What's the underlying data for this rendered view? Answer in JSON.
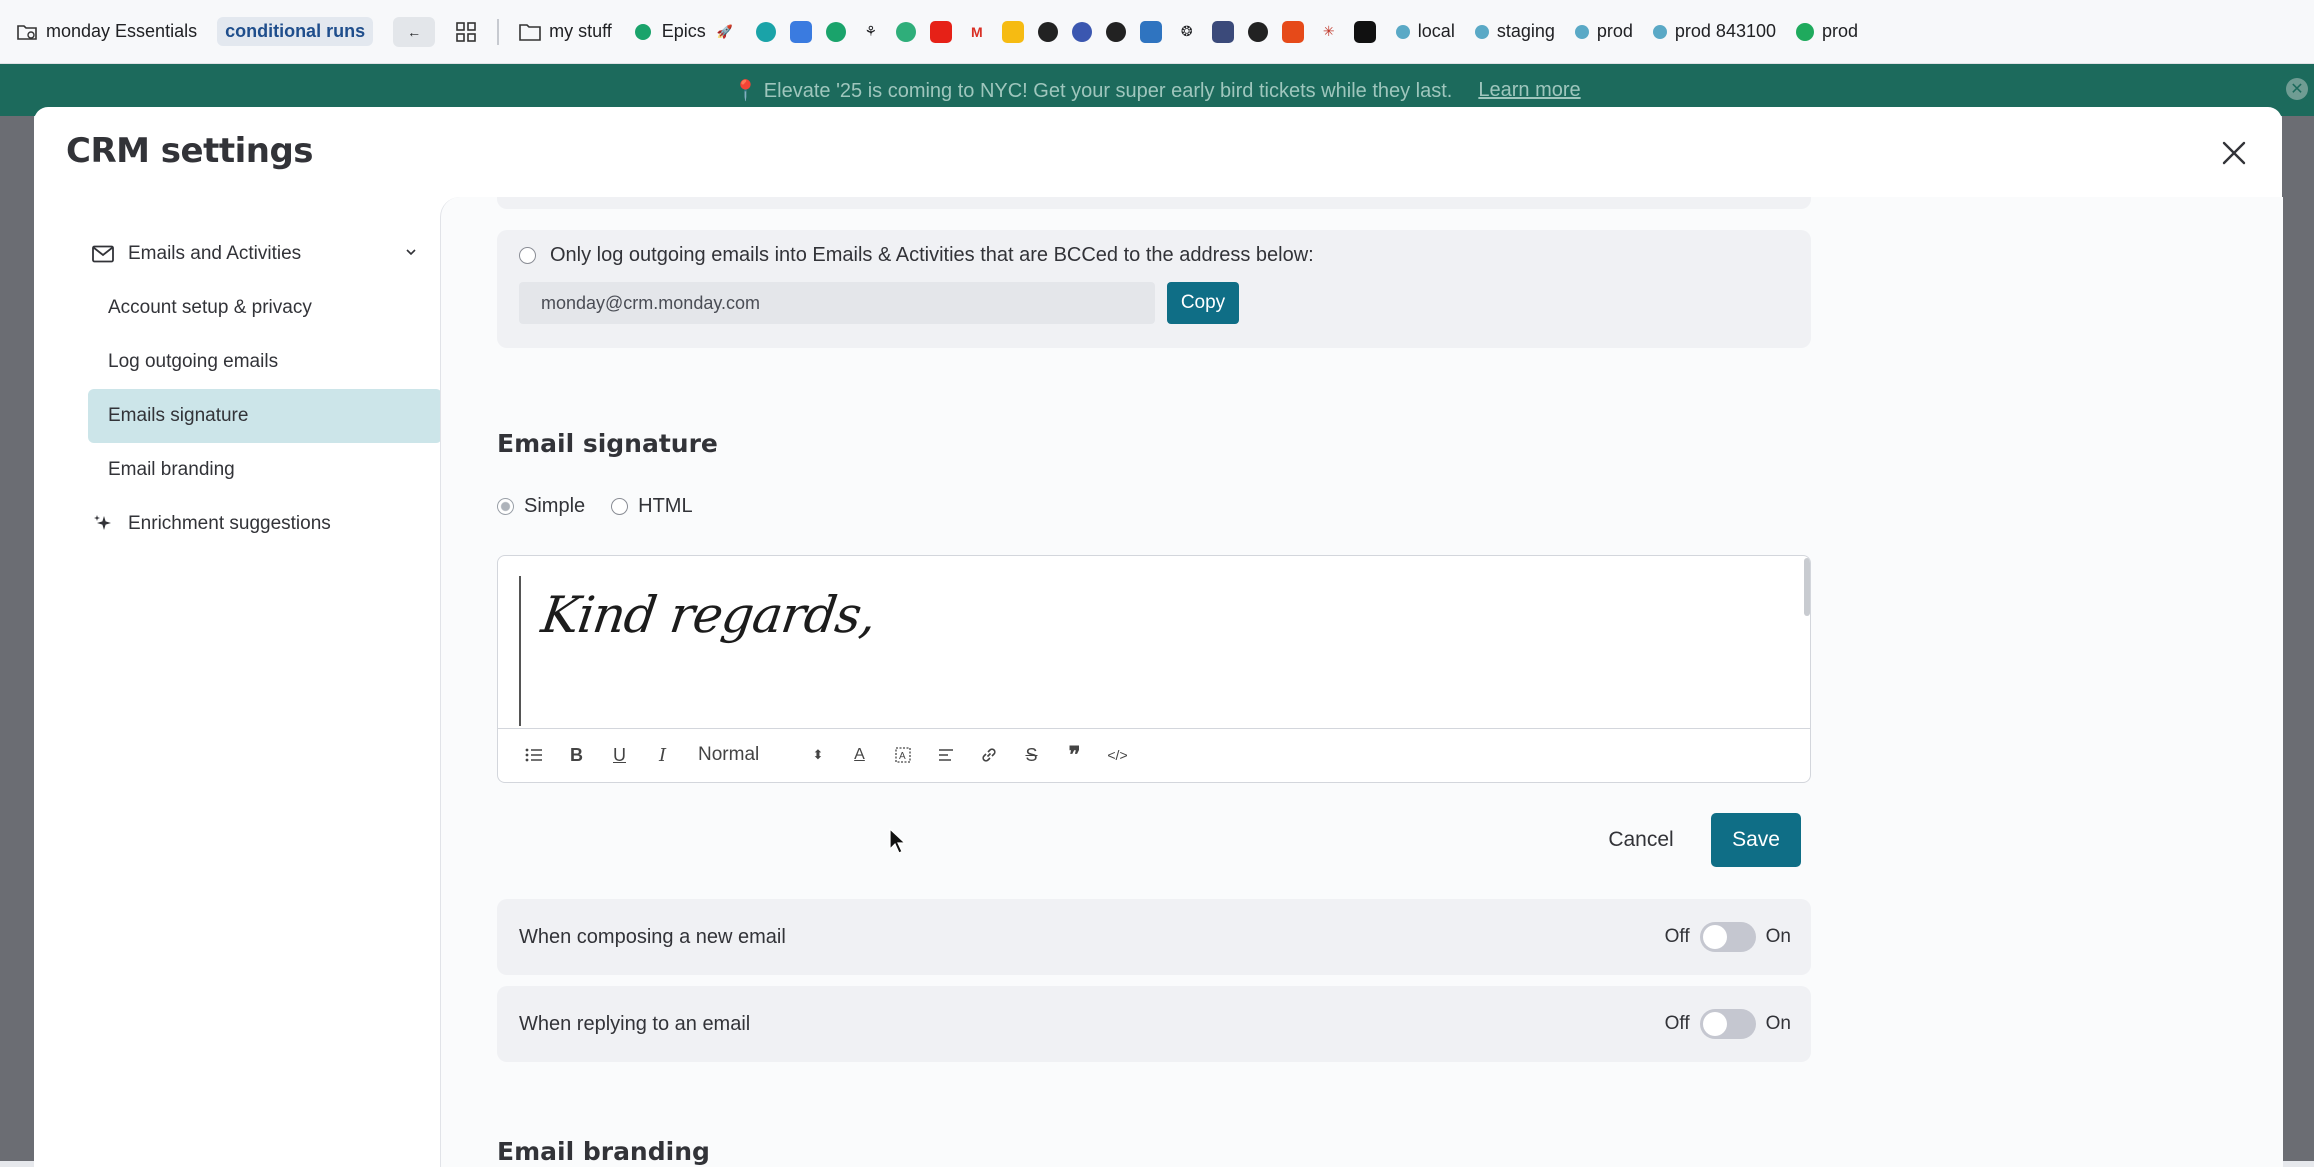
{
  "bookmarks": {
    "items": [
      {
        "label": "monday Essentials",
        "icon": "folder-gear-icon"
      },
      {
        "label": "conditional runs",
        "icon": ""
      },
      {
        "label": "",
        "icon": "arrow-left-icon"
      },
      {
        "label": "",
        "icon": "grid-icon"
      },
      {
        "label": "my stuff",
        "icon": "folder-icon"
      },
      {
        "label": "Epics",
        "icon": "monday-icon"
      },
      {
        "label": "local",
        "icon": "dot-icon"
      },
      {
        "label": "staging",
        "icon": "dot-icon"
      },
      {
        "label": "prod",
        "icon": "dot-icon"
      },
      {
        "label": "prod 843100",
        "icon": "dot-icon"
      },
      {
        "label": "prod",
        "icon": "green-dot-icon"
      }
    ]
  },
  "banner": {
    "text": "📍 Elevate '25 is coming to NYC! Get your super early bird tickets while they last.",
    "link": "Learn more"
  },
  "modal": {
    "title": "CRM settings"
  },
  "nav": {
    "section1": "Emails and Activities",
    "items": [
      {
        "label": "Account setup & privacy"
      },
      {
        "label": "Log outgoing emails"
      },
      {
        "label": "Emails signature"
      },
      {
        "label": "Email branding"
      }
    ],
    "section2": "Enrichment suggestions"
  },
  "bcc": {
    "label": "Only log outgoing emails into Emails & Activities that are BCCed to the address below:",
    "address": "monday@crm.monday.com",
    "copy": "Copy"
  },
  "signature": {
    "heading": "Email signature",
    "mode_simple": "Simple",
    "mode_html": "HTML",
    "content": "Kind regards,",
    "format_select": "Normal"
  },
  "actions": {
    "cancel": "Cancel",
    "save": "Save"
  },
  "toggles": [
    {
      "label": "When composing a new email",
      "off": "Off",
      "on": "On",
      "state": "off"
    },
    {
      "label": "When replying to an email",
      "off": "Off",
      "on": "On",
      "state": "off"
    }
  ],
  "branding_heading": "Email branding",
  "colors": {
    "accent": "#0f6e86",
    "active_nav": "#cce5e9",
    "banner": "#1c6a5c"
  }
}
